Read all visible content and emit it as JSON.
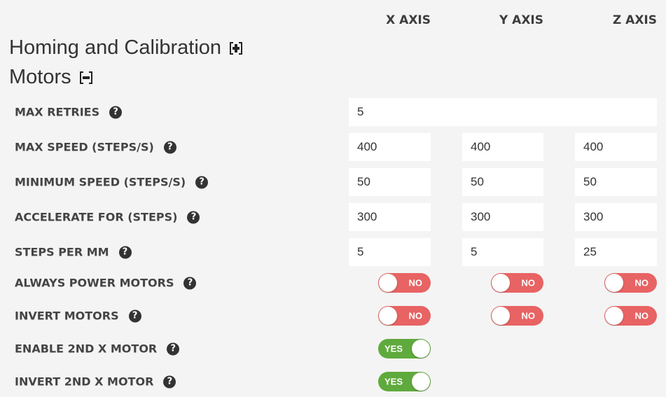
{
  "axes": {
    "x": "X AXIS",
    "y": "Y AXIS",
    "z": "Z AXIS"
  },
  "sections": {
    "homing": "Homing and Calibration",
    "motors": "Motors"
  },
  "rows": {
    "max_retries": {
      "label": "MAX RETRIES",
      "value": "5"
    },
    "max_speed": {
      "label": "MAX SPEED (STEPS/S)",
      "x": "400",
      "y": "400",
      "z": "400"
    },
    "min_speed": {
      "label": "MINIMUM SPEED (STEPS/S)",
      "x": "50",
      "y": "50",
      "z": "50"
    },
    "accelerate": {
      "label": "ACCELERATE FOR (STEPS)",
      "x": "300",
      "y": "300",
      "z": "300"
    },
    "steps_per_mm": {
      "label": "STEPS PER MM",
      "x": "5",
      "y": "5",
      "z": "25"
    },
    "always_power": {
      "label": "ALWAYS POWER MOTORS",
      "x": "NO",
      "y": "NO",
      "z": "NO"
    },
    "invert_motors": {
      "label": "INVERT MOTORS",
      "x": "NO",
      "y": "NO",
      "z": "NO"
    },
    "enable_2nd_x": {
      "label": "ENABLE 2ND X MOTOR",
      "x": "YES"
    },
    "invert_2nd_x": {
      "label": "INVERT 2ND X MOTOR",
      "x": "YES"
    }
  },
  "help_glyph": "?",
  "colors": {
    "no": "#e86363",
    "yes": "#5faa3c"
  }
}
